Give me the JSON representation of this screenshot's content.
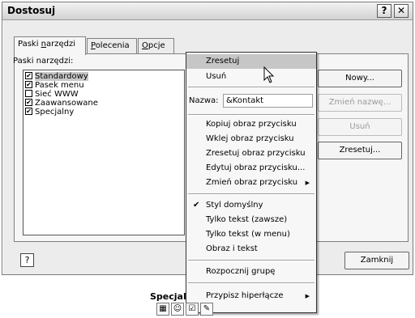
{
  "window": {
    "title": "Dostosuj",
    "help_btn": "?",
    "close_btn": "✕"
  },
  "tabs": [
    {
      "label": "Paski narzędzi",
      "pre": "Paski ",
      "ul": "n",
      "post": "arzędzi"
    },
    {
      "label": "Polecenia",
      "pre": "",
      "ul": "P",
      "post": "olecenia"
    },
    {
      "label": "Opcje",
      "pre": "",
      "ul": "O",
      "post": "pcje"
    }
  ],
  "panel": {
    "list_label": "Paski narzędzi:",
    "toolbars": [
      {
        "label": "Standardowy",
        "checked": true,
        "selected": true
      },
      {
        "label": "Pasek menu",
        "checked": true,
        "selected": false
      },
      {
        "label": "Sieć WWW",
        "checked": false,
        "selected": false
      },
      {
        "label": "Zaawansowane",
        "checked": true,
        "selected": false
      },
      {
        "label": "Specjalny",
        "checked": true,
        "selected": false
      }
    ]
  },
  "buttons": {
    "new": "Nowy...",
    "rename": "Zmień nazwę...",
    "delete": "Usuń",
    "reset": "Zresetuj...",
    "close": "Zamknij"
  },
  "menu": {
    "reset": "Zresetuj",
    "delete": "Usuń",
    "name_label": "Nazwa:",
    "name_value": "&Kontakt",
    "copy_image": "Kopiuj obraz przycisku",
    "paste_image": "Wklej obraz przycisku",
    "reset_image": "Zresetuj obraz przycisku",
    "edit_image": "Edytuj obraz przycisku...",
    "change_image": "Zmień obraz przycisku",
    "default_style": "Styl domyślny",
    "text_only_always": "Tylko tekst (zawsze)",
    "text_only_menu": "Tylko tekst (w menu)",
    "image_and_text": "Obraz i tekst",
    "begin_group": "Rozpocznij grupę",
    "assign_hyperlink": "Przypisz hiperłącze"
  },
  "toolbar_preview": {
    "title": "Specjal"
  },
  "colors": {
    "dialog_bg": "#ececec",
    "menu_highlight": "#c6c6c6",
    "panel_bg": "#f6f6f6"
  }
}
